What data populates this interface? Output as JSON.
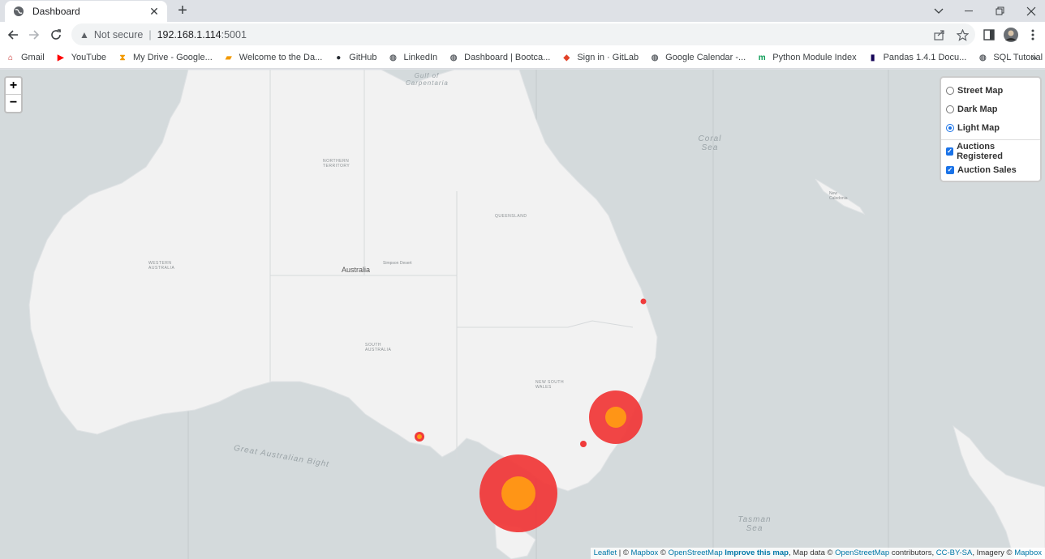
{
  "tab": {
    "title": "Dashboard",
    "close": "✕"
  },
  "newtab": "+",
  "omnibox": {
    "warning": "Not secure",
    "separator": "|",
    "url": "192.168.1.114",
    "port": ":5001"
  },
  "bookmarks": [
    {
      "label": "Gmail",
      "icon": "home-icon",
      "color": "#c5221f"
    },
    {
      "label": "YouTube",
      "icon": "youtube-icon",
      "color": "#ff0000"
    },
    {
      "label": "My Drive - Google...",
      "icon": "hourglass-icon",
      "color": "#f29900"
    },
    {
      "label": "Welcome to the Da...",
      "icon": "notebook-icon",
      "color": "#f29900"
    },
    {
      "label": "GitHub",
      "icon": "github-icon",
      "color": "#24292f"
    },
    {
      "label": "LinkedIn",
      "icon": "globe-icon",
      "color": "#5f6368"
    },
    {
      "label": "Dashboard | Bootca...",
      "icon": "globe-icon",
      "color": "#5f6368"
    },
    {
      "label": "Sign in · GitLab",
      "icon": "gitlab-icon",
      "color": "#e24329"
    },
    {
      "label": "Google Calendar -...",
      "icon": "globe-icon",
      "color": "#5f6368"
    },
    {
      "label": "Python Module Index",
      "icon": "m-icon",
      "color": "#0f9d58"
    },
    {
      "label": "Pandas 1.4.1 Docu...",
      "icon": "pandas-icon",
      "color": "#150458"
    },
    {
      "label": "SQL Tutorial",
      "icon": "globe-icon",
      "color": "#5f6368"
    }
  ],
  "bookmarks_more": "»",
  "map": {
    "zoom_in": "+",
    "zoom_out": "−",
    "base_layers": [
      {
        "label": "Street Map",
        "selected": false
      },
      {
        "label": "Dark Map",
        "selected": false
      },
      {
        "label": "Light Map",
        "selected": true
      }
    ],
    "overlays": [
      {
        "label": "Auctions Registered",
        "checked": true
      },
      {
        "label": "Auction Sales",
        "checked": true
      }
    ],
    "labels": {
      "australia": "Australia",
      "gulf": "Gulf of Carpentaria",
      "coral": "Coral Sea",
      "tasman": "Tasman Sea",
      "bight": "Great Australian Bight",
      "northern_territory": "NORTHERN TERRITORY",
      "western_australia": "WESTERN AUSTRALIA",
      "south_australia": "SOUTH AUSTRALIA",
      "queensland": "QUEENSLAND",
      "nsw": "NEW SOUTH WALES",
      "simpson": "Simpson Desert",
      "new_caledonia": "New Caledonia"
    },
    "attribution": {
      "leaflet": "Leaflet",
      "sep1": " | © ",
      "mapbox": "Mapbox",
      "sep2": " © ",
      "osm": "OpenStreetMap",
      "improve": "Improve this map",
      "mapdata": ", Map data © ",
      "osm2": "OpenStreetMap",
      "contrib": " contributors, ",
      "ccbysa": "CC-BY-SA",
      "imagery": ", Imagery © ",
      "mapbox2": "Mapbox"
    },
    "colors": {
      "land": "#f2f2f2",
      "water": "#d4dadc",
      "outer_circle": "#f03b3b",
      "inner_circle": "#ff9a14"
    }
  }
}
